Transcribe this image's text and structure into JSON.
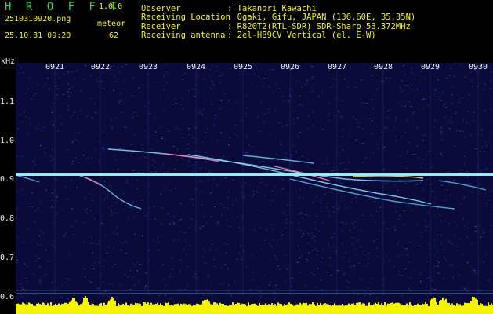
{
  "header": {
    "app_title": "H R O F F T",
    "version": "1.0.0",
    "file_name": "2510310920.png",
    "meteor_label": "meteor",
    "date_time": "25.10.31 09:20",
    "meteor_count": "62"
  },
  "info": [
    {
      "key": "Observer",
      "value": ": Takanori Kawachi"
    },
    {
      "key": "Receiving Location",
      "value": ": Ogaki, Gifu, JAPAN (136.60E, 35.35N)"
    },
    {
      "key": "Receiver",
      "value": ": R820T2(RTL-SDR) SDR-Sharp 53.372MHz"
    },
    {
      "key": "Receiving antenna",
      "value": ": 2el-HB9CV Vertical (el. E-W)"
    }
  ],
  "spectrogram": {
    "y_unit": "kHz",
    "x_ticks": [
      "0921",
      "0922",
      "0923",
      "0924",
      "0925",
      "0926",
      "0927",
      "0928",
      "0929",
      "0930"
    ],
    "y_ticks": [
      "1.1",
      "1.0",
      "0.9",
      "0.8",
      "0.7",
      "0.6"
    ],
    "colors": {
      "background": "#0b0b3a",
      "carrier": "#9be7ff",
      "bars": "#f4f400",
      "text": "#f0f0f0",
      "title": "#34d24c"
    }
  }
}
